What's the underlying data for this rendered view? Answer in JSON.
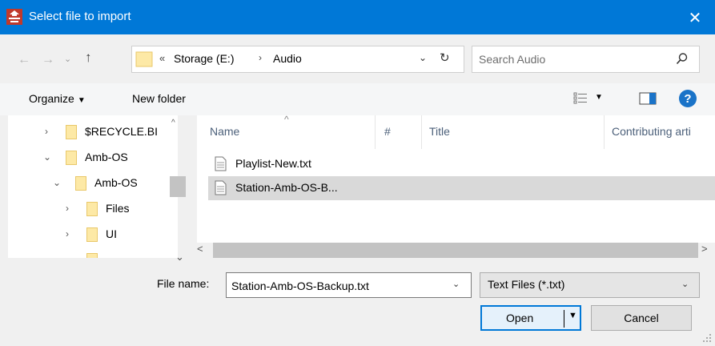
{
  "window": {
    "title": "Select file to import",
    "close_glyph": "✕",
    "app_icon": "app-icon"
  },
  "navigation": {
    "back_glyph": "←",
    "forward_glyph": "→",
    "recent_glyph": "⌄",
    "up_glyph": "↑"
  },
  "address": {
    "overflow_glyph": "«",
    "segments": [
      "Storage (E:)",
      "Audio"
    ],
    "separator_glyph": "›",
    "dropdown_glyph": "⌄",
    "refresh_glyph": "↻"
  },
  "search": {
    "placeholder": "Search Audio",
    "value": ""
  },
  "toolbar": {
    "organize_label": "Organize",
    "organize_arrow": "▼",
    "new_folder_label": "New folder",
    "view_arrow": "▼",
    "help_label": "?"
  },
  "nav_pane": {
    "items": [
      {
        "label": "$RECYCLE.BI",
        "arrow": "›"
      },
      {
        "label": "Amb-OS",
        "arrow": "⌄"
      },
      {
        "label": "Amb-OS",
        "arrow": "⌄"
      },
      {
        "label": "Files",
        "arrow": "›"
      },
      {
        "label": "UI",
        "arrow": "›"
      }
    ],
    "scroll_up_glyph": "^",
    "scroll_down_glyph": "⌄"
  },
  "file_list": {
    "columns": [
      "Name",
      "#",
      "Title",
      "Contributing arti"
    ],
    "sort_glyph": "^",
    "files": [
      {
        "name": "Playlist-New.txt",
        "selected": false
      },
      {
        "name": "Station-Amb-OS-B...",
        "selected": true
      }
    ],
    "hscroll_left_glyph": "<",
    "hscroll_right_glyph": ">"
  },
  "footer": {
    "file_name_label": "File name:",
    "file_name_value": "Station-Amb-OS-Backup.txt",
    "combo_arrow": "⌄",
    "file_type": "Text Files (*.txt)",
    "open_label": "Open",
    "open_arrow": "▼",
    "cancel_label": "Cancel"
  },
  "colors": {
    "titlebar": "#0078d7",
    "selection": "#d9d9d9",
    "folder": "#fde9a6",
    "default_button_border": "#0078d7"
  }
}
